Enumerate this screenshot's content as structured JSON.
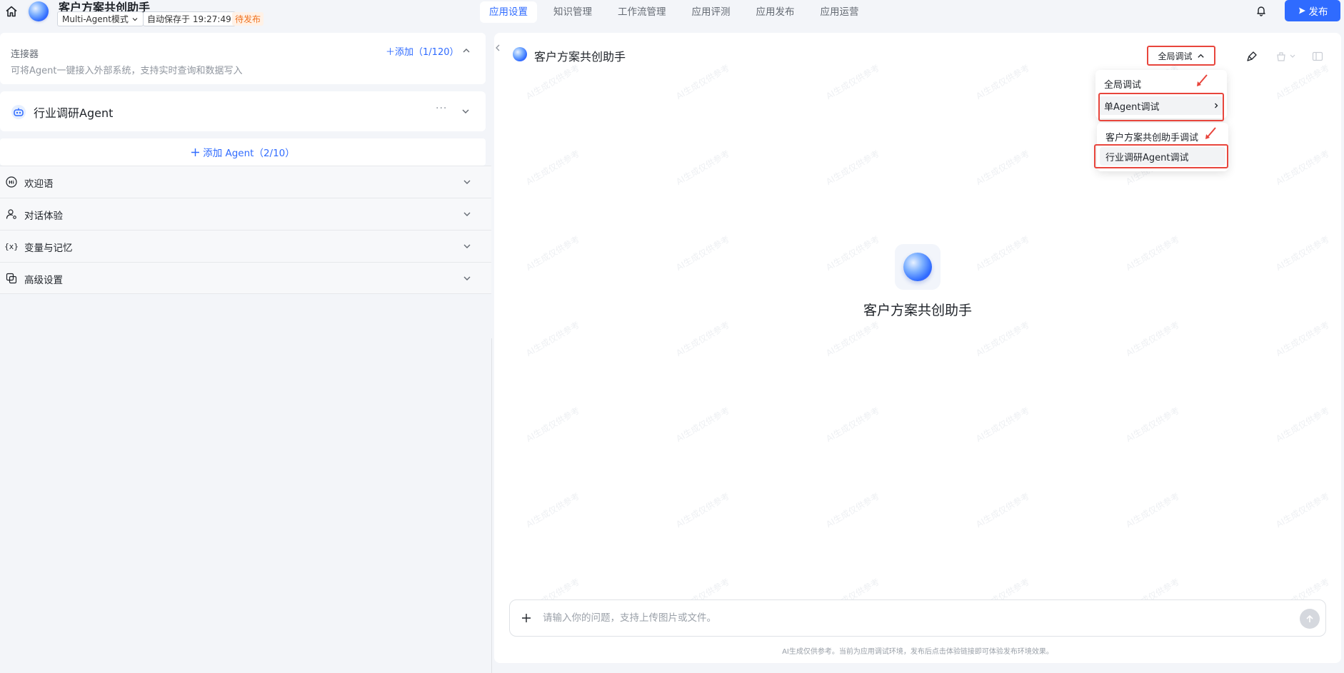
{
  "header": {
    "app_title": "客户方案共创助手",
    "mode": "Multi-Agent模式",
    "autosave": "自动保存于 19:27:49",
    "status": "待发布",
    "publish_label": "发布"
  },
  "nav": {
    "tabs": [
      {
        "label": "应用设置",
        "active": true
      },
      {
        "label": "知识管理"
      },
      {
        "label": "工作流管理"
      },
      {
        "label": "应用评测"
      },
      {
        "label": "应用发布"
      },
      {
        "label": "应用运营"
      }
    ]
  },
  "connector": {
    "title": "连接器",
    "description": "可将Agent一键接入外部系统，支持实时查询和数据写入",
    "add_label": "添加（1/120）"
  },
  "agent": {
    "name": "行业调研Agent",
    "more": "···"
  },
  "add_agent_label": "添加 Agent（2/10）",
  "sections": [
    {
      "label": "欢迎语",
      "icon": "hi-icon"
    },
    {
      "label": "对话体验",
      "icon": "user-settings-icon"
    },
    {
      "label": "变量与记忆",
      "icon": "variable-icon"
    },
    {
      "label": "高级设置",
      "icon": "copy-settings-icon"
    }
  ],
  "debug": {
    "title": "客户方案共创助手",
    "select_label": "全局调试",
    "menu": [
      {
        "label": "全局调试"
      },
      {
        "label": "单Agent调试"
      }
    ],
    "submenu": [
      {
        "label": "客户方案共创助手调试"
      },
      {
        "label": "行业调研Agent调试"
      }
    ]
  },
  "center": {
    "title": "客户方案共创助手"
  },
  "chat": {
    "placeholder": "请输入你的问题，支持上传图片或文件。",
    "footer": "AI生成仅供参考。当前为应用调试环境，发布后点击体验链接即可体验发布环境效果。"
  },
  "watermark_text": "AI生成仅供参考",
  "colors": {
    "primary": "#2f6bff",
    "annotation_red": "#e8453c",
    "status_orange": "#f07320"
  }
}
